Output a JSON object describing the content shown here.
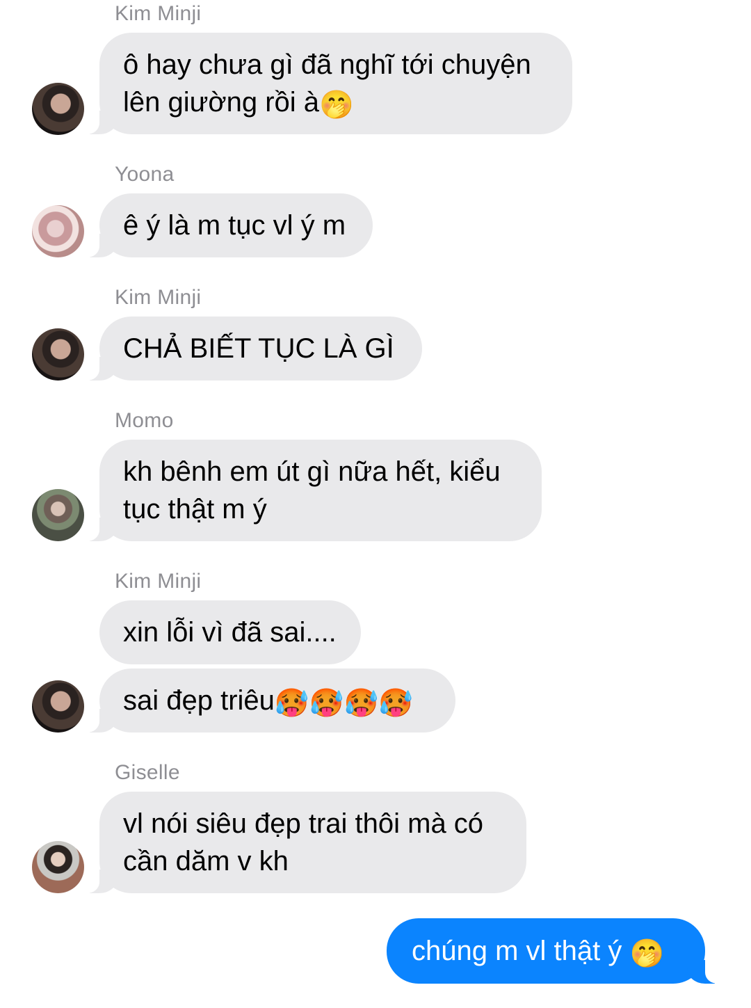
{
  "messages": [
    {
      "sender": "Kim Minji",
      "text": "ô hay chưa gì đã nghĩ tới chuyện\nlên giường rồi à",
      "emoji": "🤭",
      "avatar": "kim-minji-avatar"
    },
    {
      "sender": "Yoona",
      "text": "ê ý là m tục vl ý m",
      "avatar": "yoona-avatar"
    },
    {
      "sender": "Kim Minji",
      "text": "CHẢ BIẾT TỤC LÀ GÌ",
      "avatar": "kim-minji-avatar"
    },
    {
      "sender": "Momo",
      "text": "kh bênh em út gì nữa hết, kiểu\ntục thật m ý",
      "avatar": "momo-avatar"
    },
    {
      "sender": "Kim Minji",
      "text": "xin lỗi vì đã sai....",
      "avatar": "kim-minji-avatar"
    },
    {
      "text": "sai đẹp triêu",
      "emoji": "🥵🥵🥵🥵",
      "avatar": "kim-minji-avatar"
    },
    {
      "sender": "Giselle",
      "text": "vl nói siêu đẹp trai thôi mà có\ncần dăm v kh",
      "avatar": "giselle-avatar"
    }
  ],
  "outgoing": {
    "text": "chúng m vl thật ý",
    "emoji": "🤭"
  },
  "colors": {
    "incoming_bubble": "#e9e9eb",
    "outgoing_bubble": "#0b84fe",
    "sender_name": "#8e8e93"
  }
}
